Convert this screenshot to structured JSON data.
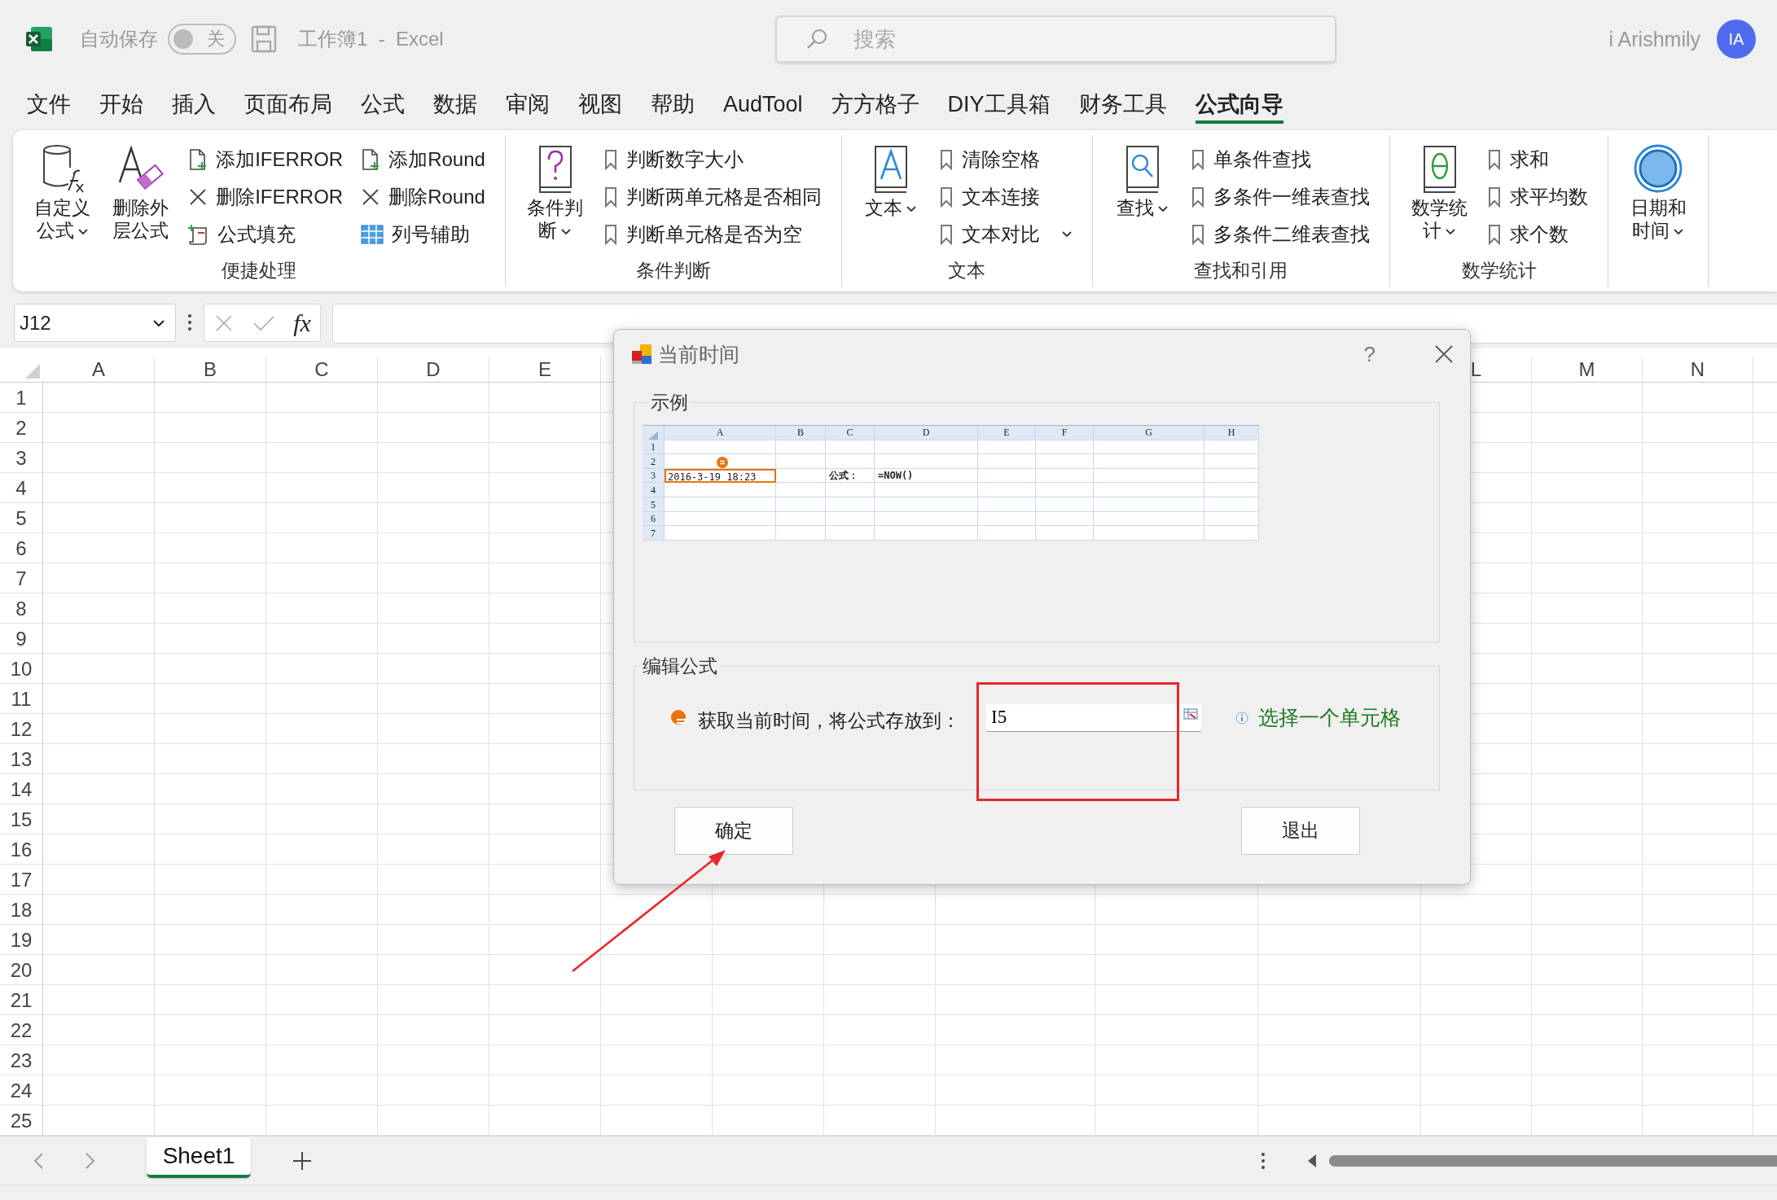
{
  "title_bar": {
    "autosave_label": "自动保存",
    "autosave_toggle": {
      "label": "关",
      "on": false
    },
    "document_title": "工作簿1  -  Excel",
    "search": {
      "placeholder": "搜索"
    },
    "user_name": "i Arishmily",
    "avatar_initials": "IA"
  },
  "ribbon_tabs": [
    {
      "label": "文件",
      "selected": false
    },
    {
      "label": "开始",
      "selected": false
    },
    {
      "label": "插入",
      "selected": false
    },
    {
      "label": "页面布局",
      "selected": false
    },
    {
      "label": "公式",
      "selected": false
    },
    {
      "label": "数据",
      "selected": false
    },
    {
      "label": "审阅",
      "selected": false
    },
    {
      "label": "视图",
      "selected": false
    },
    {
      "label": "帮助",
      "selected": false
    },
    {
      "label": "AudTool",
      "selected": false
    },
    {
      "label": "方方格子",
      "selected": false
    },
    {
      "label": "DIY工具箱",
      "selected": false
    },
    {
      "label": "财务工具",
      "selected": false
    },
    {
      "label": "公式向导",
      "selected": true
    }
  ],
  "ribbon_groups": [
    {
      "label": "便捷处理",
      "large_buttons": [
        {
          "label": "自定义公式",
          "kind": "cylinder",
          "dropdown": true
        },
        {
          "label": "删除外层公式",
          "kind": "eraser",
          "dropdown": false
        }
      ],
      "item_columns": [
        [
          {
            "label": "添加IFERROR",
            "kind": "add",
            "dropdown": false
          },
          {
            "label": "删除IFERROR",
            "kind": "delete",
            "dropdown": false
          },
          {
            "label": "公式填充",
            "kind": "fill",
            "dropdown": false
          }
        ],
        [
          {
            "label": "添加Round",
            "kind": "add",
            "dropdown": false
          },
          {
            "label": "删除Round",
            "kind": "delete",
            "dropdown": false
          },
          {
            "label": "列号辅助",
            "kind": "grid",
            "dropdown": false
          }
        ]
      ]
    },
    {
      "label": "条件判断",
      "large_buttons": [
        {
          "label": "条件判断",
          "kind": "question",
          "dropdown": true
        }
      ],
      "item_columns": [
        [
          {
            "label": "判断数字大小",
            "kind": "bookmark",
            "dropdown": false
          },
          {
            "label": "判断两单元格是否相同",
            "kind": "bookmark",
            "dropdown": false
          },
          {
            "label": "判断单元格是否为空",
            "kind": "bookmark",
            "dropdown": false
          }
        ]
      ]
    },
    {
      "label": "文本",
      "large_buttons": [
        {
          "label": "文本",
          "kind": "letter",
          "dropdown": true
        }
      ],
      "item_columns": [
        [
          {
            "label": "清除空格",
            "kind": "bookmark",
            "dropdown": false
          },
          {
            "label": "文本连接",
            "kind": "bookmark",
            "dropdown": false
          },
          {
            "label": "文本对比",
            "kind": "bookmark",
            "dropdown": true
          }
        ]
      ]
    },
    {
      "label": "查找和引用",
      "large_buttons": [
        {
          "label": "查找",
          "kind": "magnifier",
          "dropdown": true
        }
      ],
      "item_columns": [
        [
          {
            "label": "单条件查找",
            "kind": "bookmark",
            "dropdown": false
          },
          {
            "label": "多条件一维表查找",
            "kind": "bookmark",
            "dropdown": false
          },
          {
            "label": "多条件二维表查找",
            "kind": "bookmark",
            "dropdown": false
          }
        ]
      ]
    },
    {
      "label": "数学统计",
      "large_buttons": [
        {
          "label": "数学统计",
          "kind": "theta",
          "dropdown": true
        }
      ],
      "item_columns": [
        [
          {
            "label": "求和",
            "kind": "bookmark",
            "dropdown": false
          },
          {
            "label": "求平均数",
            "kind": "bookmark",
            "dropdown": false
          },
          {
            "label": "求个数",
            "kind": "bookmark",
            "dropdown": false
          }
        ]
      ]
    },
    {
      "large_buttons": [
        {
          "label": "日期和时间",
          "kind": "circle",
          "dropdown": true
        }
      ]
    }
  ],
  "formula_bar": {
    "name_box": "J12",
    "function_symbol": "fx"
  },
  "column_headers": [
    "A",
    "B",
    "C",
    "D",
    "E",
    "L",
    "M",
    "N"
  ],
  "row_numbers": [
    "1",
    "2",
    "3",
    "4",
    "5",
    "6",
    "7",
    "8",
    "9",
    "10",
    "11",
    "12",
    "13",
    "14",
    "15",
    "16",
    "17",
    "18",
    "19",
    "20",
    "21",
    "22",
    "23",
    "24",
    "25"
  ],
  "sheet_tabs": [
    {
      "label": "Sheet1",
      "selected": true
    }
  ],
  "dialog": {
    "title": "当前时间",
    "help": "?",
    "example_group": {
      "title": "示例",
      "sheet": {
        "columns": [
          "A",
          "B",
          "C",
          "D",
          "E",
          "F",
          "G",
          "H"
        ],
        "rows": [
          {
            "label": "1"
          },
          {
            "label": "2"
          },
          {
            "label": "3",
            "cells": [
              {
                "text": "2016-3-19 18:23",
                "selected": true
              },
              {
                "selected": false
              },
              {
                "text": "公式：",
                "selected": false
              },
              {
                "text": "=NOW()",
                "selected": false
              },
              {
                "selected": false
              },
              {
                "selected": false
              },
              {
                "selected": false
              },
              {
                "selected": false
              }
            ]
          },
          {
            "label": "4"
          },
          {
            "label": "5"
          },
          {
            "label": "6"
          },
          {
            "label": "7"
          }
        ]
      }
    },
    "edit_group": {
      "title": "编辑公式",
      "prompt": "获取当前时间，将公式存放到：",
      "target_cell": "I5",
      "hint": "选择一个单元格"
    },
    "buttons": [
      {
        "label": "确定"
      },
      {
        "label": "退出"
      }
    ]
  }
}
